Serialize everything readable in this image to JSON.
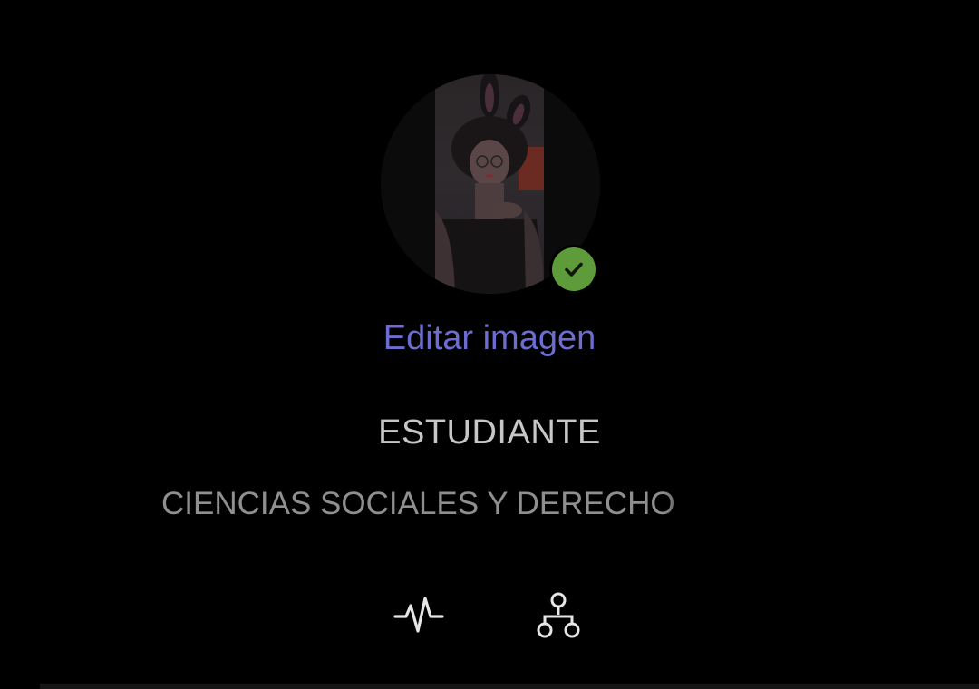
{
  "profile": {
    "edit_image_label": "Editar imagen",
    "role": "ESTUDIANTE",
    "field": "CIENCIAS SOCIALES Y DERECHO",
    "verified_icon": "check-circle-icon",
    "avatar_icon": "profile-photo"
  },
  "actions": {
    "activity_icon": "activity-pulse-icon",
    "network_icon": "network-hierarchy-icon"
  },
  "colors": {
    "background": "#000000",
    "link": "#6d6cd0",
    "verified": "#5e9b3a",
    "text_primary": "#c7c7c7",
    "text_secondary": "#8f8f8f"
  }
}
